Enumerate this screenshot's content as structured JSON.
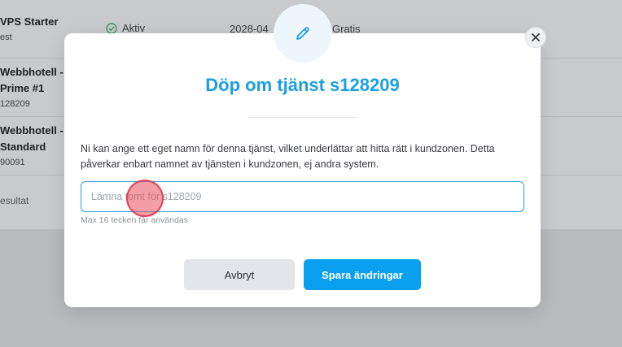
{
  "background": {
    "rows": [
      {
        "title": "VPS Starter",
        "sub": "est",
        "status": "Aktiv",
        "date": "2028-04",
        "price": "Gratis"
      },
      {
        "title_lines": [
          "Webbhotell -",
          "Prime #1"
        ],
        "sub": "128209"
      },
      {
        "title_lines": [
          "Webbhotell -",
          "Standard"
        ],
        "sub": "90091"
      }
    ],
    "result_label": "esultat"
  },
  "modal": {
    "icon": "pencil-icon",
    "title": "Döp om tjänst s128209",
    "description": "Ni kan ange ett eget namn för denna tjänst, vilket underlättar att hitta rätt i kundzonen. Detta påverkar enbart namnet av tjänsten i kundzonen, ej andra system.",
    "input": {
      "value": "",
      "placeholder": "Lämna tomt för s128209"
    },
    "hint": "Max 16 tecken får användas",
    "cancel_label": "Avbryt",
    "save_label": "Spara ändringar"
  },
  "colors": {
    "accent": "#1a9fe0",
    "primary_button": "#0aa0f0",
    "status_ok": "#3a9a5a"
  }
}
